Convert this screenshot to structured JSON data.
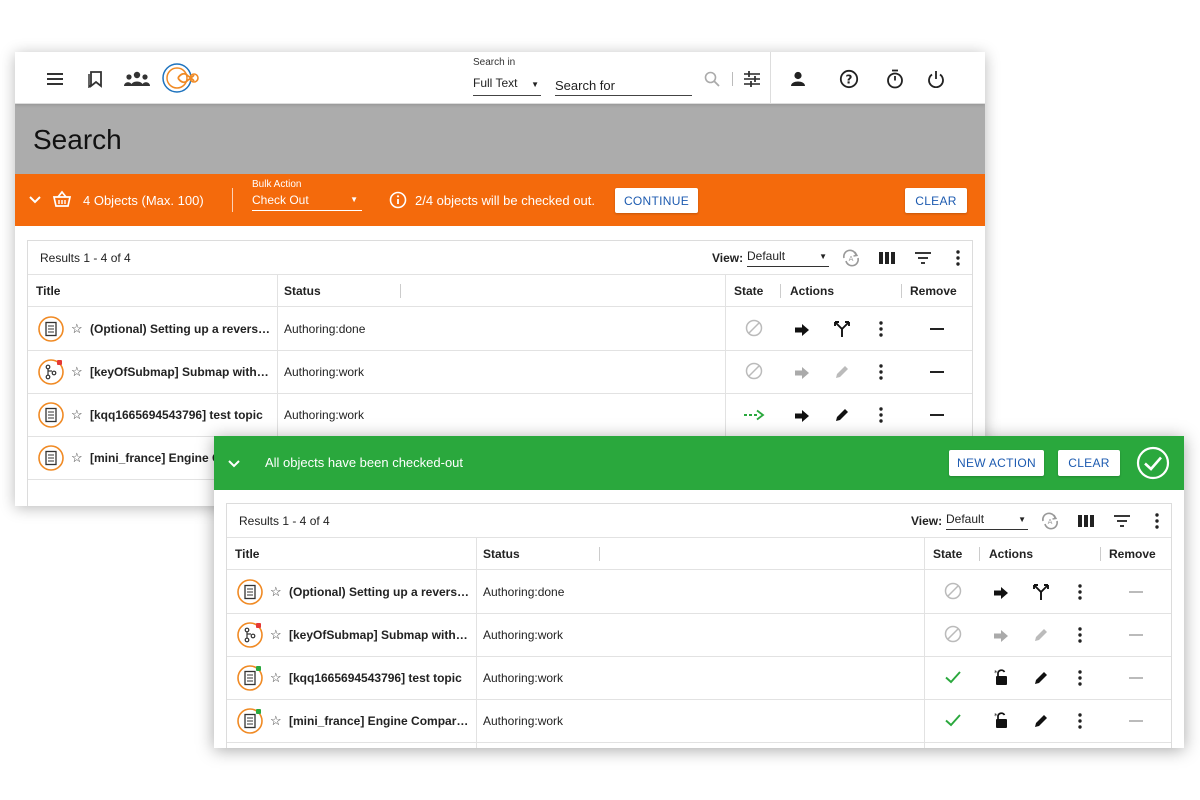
{
  "app": {
    "search_in_label": "Search in",
    "search_in_value": "Full Text",
    "search_placeholder": "Search for",
    "page_title": "Search"
  },
  "bulk_bar": {
    "object_count": "4 Objects (Max. 100)",
    "bulk_action_label": "Bulk Action",
    "bulk_action_value": "Check Out",
    "info_message": "2/4 objects will be checked out.",
    "continue_label": "CONTINUE",
    "clear_label": "CLEAR",
    "color": "#f46a0c"
  },
  "success_bar": {
    "message": "All objects have been checked-out",
    "new_action_label": "NEW ACTION",
    "clear_label": "CLEAR",
    "color": "#2aa83d"
  },
  "results": {
    "count_label": "Results 1 - 4 of 4",
    "view_label": "View:",
    "view_value": "Default",
    "columns": {
      "title": "Title",
      "status": "Status",
      "state": "State",
      "actions": "Actions",
      "remove": "Remove"
    }
  },
  "rows_before": [
    {
      "title": "(Optional) Setting up a reverse pr...",
      "status": "Authoring:done",
      "icon": "document-icon",
      "state": "blocked",
      "edit_enabled": true,
      "second_action": "branch-icon"
    },
    {
      "title": "[keyOfSubmap] Submap with key...",
      "status": "Authoring:work",
      "icon": "map-icon",
      "state": "blocked",
      "edit_enabled": false,
      "second_action": "edit-icon"
    },
    {
      "title": "[kqq1665694543796] test topic",
      "status": "Authoring:work",
      "icon": "document-icon",
      "state": "pending",
      "edit_enabled": true,
      "second_action": "edit-icon"
    },
    {
      "title": "[mini_france] Engine Com...",
      "status": "",
      "icon": "document-icon",
      "state": "",
      "edit_enabled": true,
      "second_action": ""
    }
  ],
  "rows_after": [
    {
      "title": "(Optional) Setting up a reverse pr...",
      "status": "Authoring:done",
      "icon": "document-icon",
      "state": "blocked"
    },
    {
      "title": "[keyOfSubmap] Submap with key...",
      "status": "Authoring:work",
      "icon": "map-icon",
      "state": "blocked"
    },
    {
      "title": "[kqq1665694543796] test topic",
      "status": "Authoring:work",
      "icon": "document-icon",
      "state": "checked"
    },
    {
      "title": "[mini_france] Engine Compartme...",
      "status": "Authoring:work",
      "icon": "document-icon",
      "state": "checked"
    }
  ]
}
